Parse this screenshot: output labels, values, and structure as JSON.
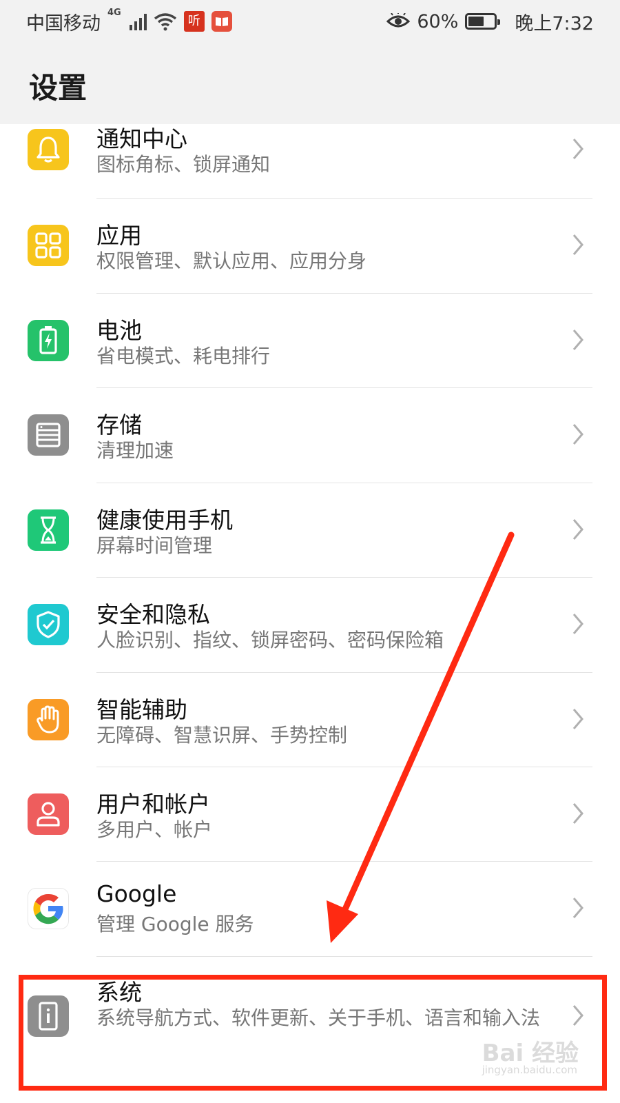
{
  "status_bar": {
    "carrier": "中国移动",
    "network": "4G",
    "app_badge_ting": "听",
    "battery_percent_text": "60%",
    "battery_level": 0.6,
    "time": "晚上7:32"
  },
  "header": {
    "title": "设置"
  },
  "settings": [
    {
      "title": "通知中心",
      "subtitle": "图标角标、锁屏通知",
      "icon": "bell-icon",
      "color": "#f7c51c"
    },
    {
      "title": "应用",
      "subtitle": "权限管理、默认应用、应用分身",
      "icon": "apps-grid-icon",
      "color": "#f7c51c"
    },
    {
      "title": "电池",
      "subtitle": "省电模式、耗电排行",
      "icon": "battery-charging-icon",
      "color": "#25c26a"
    },
    {
      "title": "存储",
      "subtitle": "清理加速",
      "icon": "storage-icon",
      "color": "#8e8e8e"
    },
    {
      "title": "健康使用手机",
      "subtitle": "屏幕时间管理",
      "icon": "hourglass-icon",
      "color": "#1fc878"
    },
    {
      "title": "安全和隐私",
      "subtitle": "人脸识别、指纹、锁屏密码、密码保险箱",
      "icon": "shield-check-icon",
      "color": "#1fc9d0"
    },
    {
      "title": "智能辅助",
      "subtitle": "无障碍、智慧识屏、手势控制",
      "icon": "hand-icon",
      "color": "#f99b26"
    },
    {
      "title": "用户和帐户",
      "subtitle": "多用户、帐户",
      "icon": "user-icon",
      "color": "#ee5d5d"
    },
    {
      "title": "Google",
      "subtitle": "管理 Google 服务",
      "icon": "google-icon",
      "color": "#ffffff"
    },
    {
      "title": "系统",
      "subtitle": "系统导航方式、软件更新、关于手机、语言和输入法",
      "icon": "phone-info-icon",
      "color": "#8e8e8e"
    }
  ],
  "watermark": {
    "text": "Bai 经验",
    "sub": "jingyan.baidu.com"
  },
  "annotation_colors": {
    "arrow": "#ff2a12",
    "highlight": "#ff2a12"
  }
}
